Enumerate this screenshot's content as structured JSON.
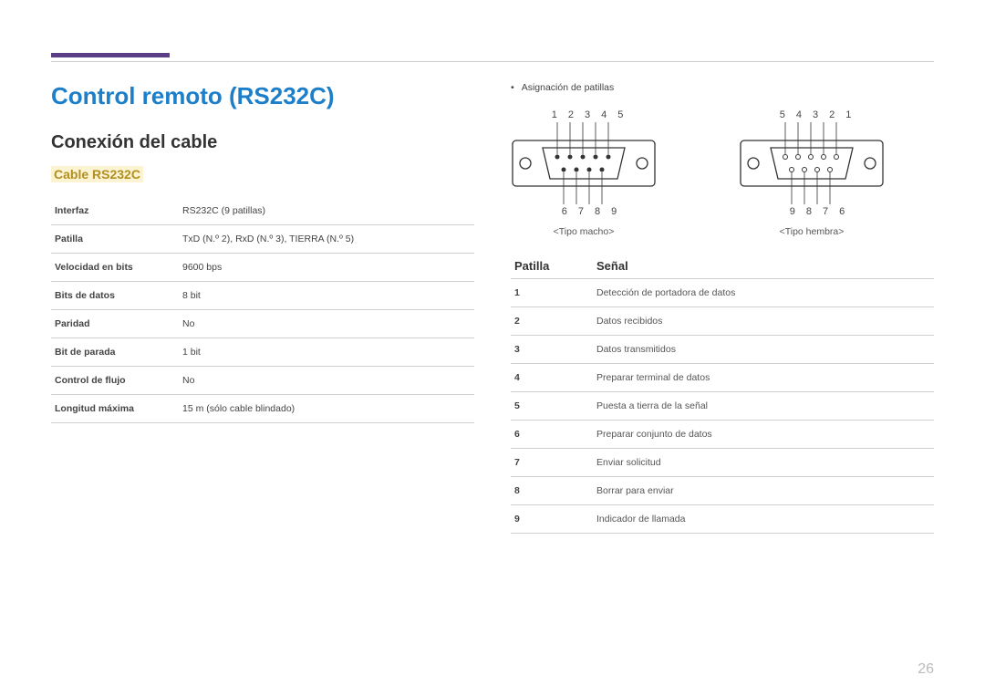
{
  "page": {
    "number": "26"
  },
  "headings": {
    "title": "Control remoto (RS232C)",
    "subtitle": "Conexión del cable",
    "cable": "Cable RS232C"
  },
  "spec": {
    "rows": [
      {
        "k": "Interfaz",
        "v": "RS232C (9 patillas)"
      },
      {
        "k": "Patilla",
        "v": "TxD (N.º 2), RxD (N.º 3), TIERRA (N.º 5)"
      },
      {
        "k": "Velocidad en bits",
        "v": "9600 bps"
      },
      {
        "k": "Bits de datos",
        "v": "8 bit"
      },
      {
        "k": "Paridad",
        "v": "No"
      },
      {
        "k": "Bit de parada",
        "v": "1 bit"
      },
      {
        "k": "Control de flujo",
        "v": "No"
      },
      {
        "k": "Longitud máxima",
        "v": "15 m (sólo cable blindado)"
      }
    ]
  },
  "right": {
    "bullet": "Asignación de patillas",
    "connectors": {
      "male": {
        "top": [
          "1",
          "2",
          "3",
          "4",
          "5"
        ],
        "bottom": [
          "6",
          "7",
          "8",
          "9"
        ],
        "label": "<Tipo macho>"
      },
      "female": {
        "top": [
          "5",
          "4",
          "3",
          "2",
          "1"
        ],
        "bottom": [
          "9",
          "8",
          "7",
          "6"
        ],
        "label": "<Tipo hembra>"
      }
    },
    "signal": {
      "h1": "Patilla",
      "h2": "Señal",
      "rows": [
        {
          "p": "1",
          "s": "Detección de portadora de datos"
        },
        {
          "p": "2",
          "s": "Datos recibidos"
        },
        {
          "p": "3",
          "s": "Datos transmitidos"
        },
        {
          "p": "4",
          "s": "Preparar terminal de datos"
        },
        {
          "p": "5",
          "s": "Puesta a tierra de la señal"
        },
        {
          "p": "6",
          "s": "Preparar conjunto de datos"
        },
        {
          "p": "7",
          "s": "Enviar solicitud"
        },
        {
          "p": "8",
          "s": "Borrar para enviar"
        },
        {
          "p": "9",
          "s": "Indicador de llamada"
        }
      ]
    }
  }
}
